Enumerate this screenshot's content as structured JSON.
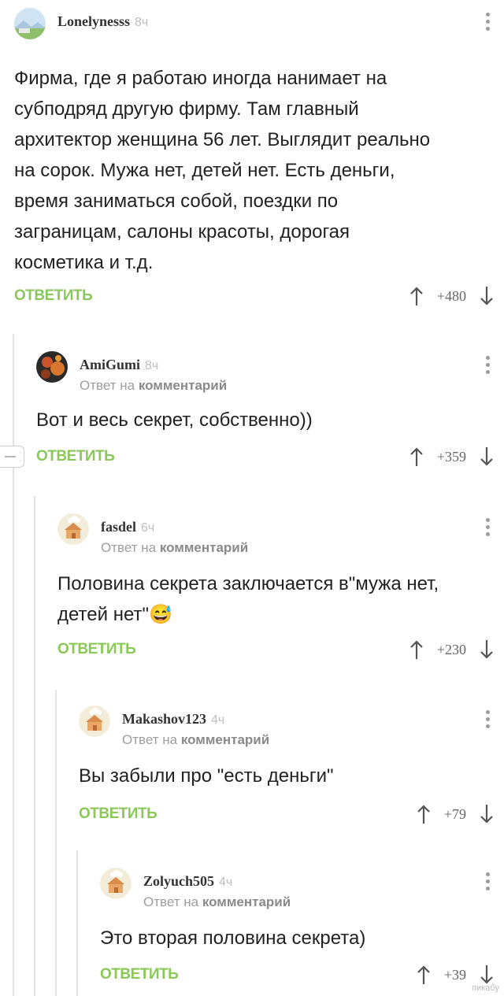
{
  "colors": {
    "reply": "#8ac858",
    "thread_line": "#e4e4e4",
    "text": "#222222"
  },
  "reply_label": "ОТВЕТИТЬ",
  "reply_to_prefix": "Ответ на",
  "reply_to_link": "комментарий",
  "comments": [
    {
      "author": "Lonelynesss",
      "time": "8ч",
      "avatar_icon": "landscape-avatar-icon",
      "text": "Фирма, где я работаю иногда нанимает на субподряд другую фирму. Там главный архитектор женщина 56 лет. Выглядит реально на сорок. Мужа нет, детей нет. Есть деньги, время заниматься собой, поездки по заграницам, салоны красоты, дорогая косметика и т.д.",
      "score": "+480"
    },
    {
      "author": "AmiGumi",
      "time": "8ч",
      "avatar_icon": "dark-orange-avatar-icon",
      "text": "Вот и весь секрет, собственно))",
      "score": "+359"
    },
    {
      "author": "fasdel",
      "time": "6ч",
      "avatar_icon": "default-house-avatar-icon",
      "text": "Половина секрета заключается в\"мужа нет, детей нет\"",
      "emoji": "😅",
      "score": "+230"
    },
    {
      "author": "Makashov123",
      "time": "4ч",
      "avatar_icon": "default-house-avatar-icon",
      "text": "Вы забыли про \"есть деньги\"",
      "score": "+79"
    },
    {
      "author": "Zolyuch505",
      "time": "4ч",
      "avatar_icon": "default-house-avatar-icon",
      "text": "Это вторая половина секрета)",
      "score": "+39"
    }
  ],
  "watermark": "пикабу"
}
